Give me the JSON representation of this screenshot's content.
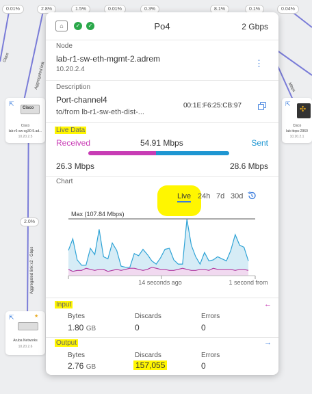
{
  "colors": {
    "accent": "#3b7ddd",
    "received": "#c83cb5",
    "sent": "#1e96d2",
    "status_ok": "#2aa84a",
    "highlight": "#fff600"
  },
  "map": {
    "top_percentages": [
      "0.01%",
      "2.8%",
      "1.5%",
      "0.01%",
      "0.3%",
      "8.1%",
      "0.1%",
      "0.04%"
    ],
    "mid_percentage": "2.0%",
    "left_node": {
      "vendor": "Cisco",
      "name": "lab-r6-sw-sg30-5.ad...",
      "ip": "10.20.2.5"
    },
    "right_node": {
      "vendor": "Cisco",
      "name": "lab-itops-2960",
      "ip": "10.20.2.1"
    },
    "bottom_node": {
      "vendor": "Aruba Networks",
      "ip": "10.20.2.6"
    },
    "link_label_1": "Aggregated link",
    "link_label_2": "Aggregated link x2 · Gbps",
    "link_label_3": "Gbps",
    "link_label_4": "Mbps"
  },
  "header": {
    "icon": "router-icon",
    "title": "Po4",
    "speed": "2 Gbps",
    "status_icons": [
      "check-circle-icon",
      "check-circle-icon"
    ]
  },
  "node": {
    "label": "Node",
    "name": "lab-r1-sw-eth-mgmt-2.adrem",
    "ip": "10.20.2.4"
  },
  "description": {
    "label": "Description",
    "port": "Port-channel4",
    "remote": "to/from lb-r1-sw-eth-dist-...",
    "mac": "00:1E:F6:25:CB:97"
  },
  "live_data": {
    "label": "Live Data",
    "received_label": "Received",
    "sent_label": "Sent",
    "total": "54.91 Mbps",
    "received": "26.3 Mbps",
    "sent": "28.6 Mbps",
    "received_fraction": 0.479
  },
  "chart": {
    "label": "Chart",
    "tabs": [
      {
        "label": "Live",
        "active": true
      },
      {
        "label": "24h",
        "active": false
      },
      {
        "label": "7d",
        "active": false
      },
      {
        "label": "30d",
        "active": false
      }
    ],
    "history_icon": "history-icon",
    "max_label": "Max (107.84 Mbps)",
    "x_labels": [
      "14 seconds ago",
      "1 second from"
    ]
  },
  "chart_data": {
    "type": "area",
    "title": "",
    "xlabel": "",
    "ylabel": "",
    "ylim": [
      0,
      110
    ],
    "max_value": 107.84,
    "series": [
      {
        "values": [
          48,
          70,
          30,
          20,
          20,
          52,
          40,
          88,
          36,
          32,
          62,
          48,
          18,
          16,
          16,
          42,
          38,
          50,
          40,
          28,
          22,
          34,
          50,
          52,
          30,
          22,
          22,
          107,
          58,
          36,
          22,
          44,
          28,
          30,
          36,
          32,
          28,
          48,
          78,
          58,
          54,
          28
        ]
      },
      {
        "values": [
          12,
          8,
          10,
          10,
          14,
          12,
          10,
          12,
          12,
          8,
          10,
          12,
          10,
          12,
          14,
          14,
          12,
          10,
          12,
          16,
          14,
          12,
          12,
          10,
          10,
          12,
          14,
          12,
          10,
          10,
          12,
          12,
          10,
          14,
          12,
          12,
          12,
          12,
          10,
          12,
          12,
          10
        ]
      }
    ]
  },
  "input": {
    "label": "Input",
    "arrow_icon": "arrow-left-icon",
    "bytes_label": "Bytes",
    "bytes_value": "1.80",
    "bytes_unit": "GB",
    "discards_label": "Discards",
    "discards_value": "0",
    "errors_label": "Errors",
    "errors_value": "0"
  },
  "output": {
    "label": "Output",
    "arrow_icon": "arrow-right-icon",
    "bytes_label": "Bytes",
    "bytes_value": "2.76",
    "bytes_unit": "GB",
    "discards_label": "Discards",
    "discards_value": "157,055",
    "errors_label": "Errors",
    "errors_value": "0"
  }
}
